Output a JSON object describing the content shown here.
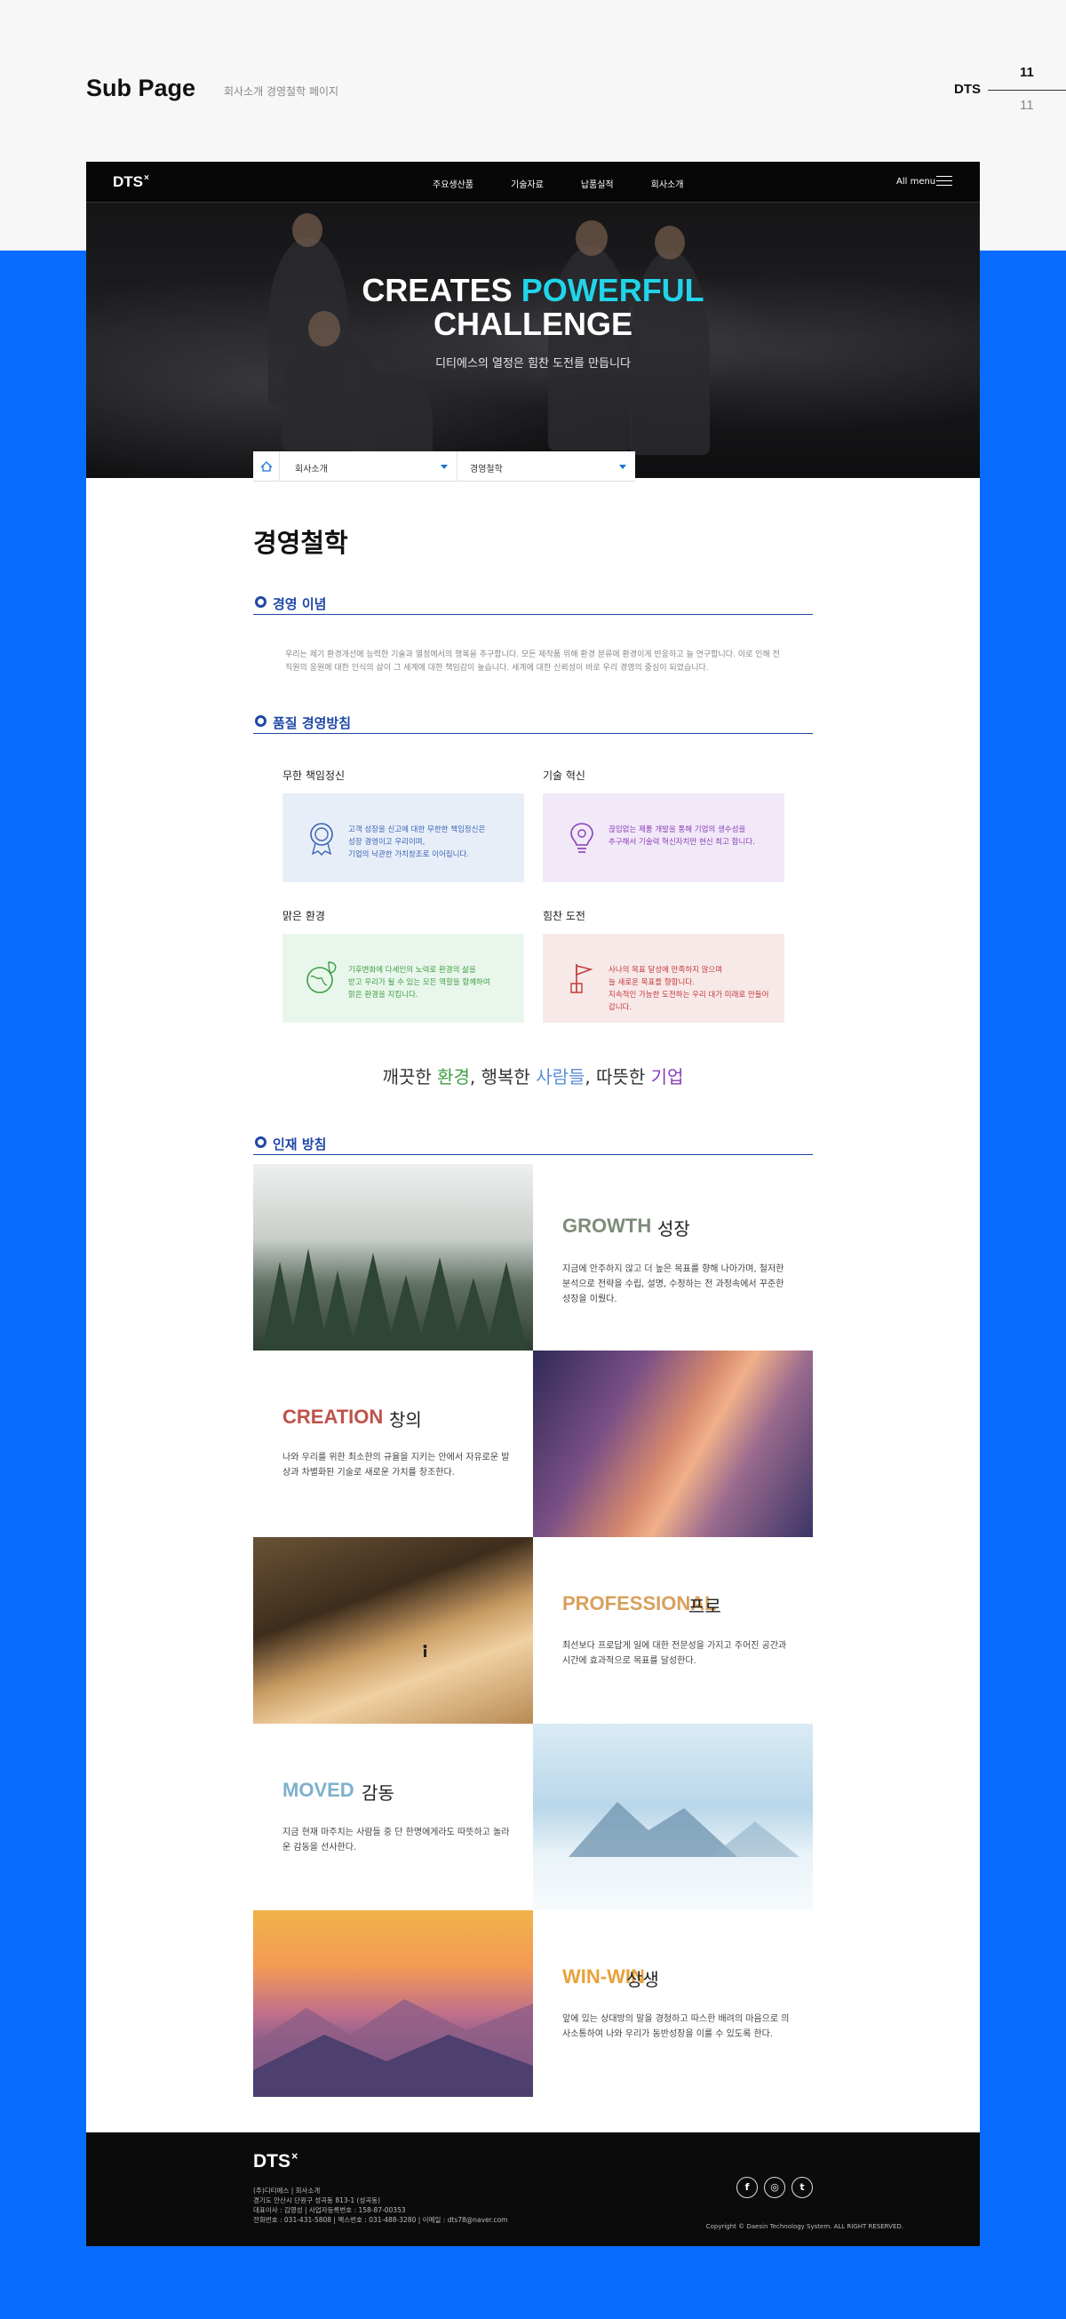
{
  "presentation": {
    "title": "Sub Page",
    "subtitle": "회사소개 경영철학 페이지",
    "brand": "DTS",
    "page": "11",
    "total": "11"
  },
  "site": {
    "logo": "DTS",
    "logo_mark": "×",
    "nav": [
      "주요생산품",
      "기술자료",
      "납품실적",
      "회사소개"
    ],
    "all_menu": "All menu"
  },
  "hero": {
    "line1_a": "CREATES",
    "line1_b": "POWERFUL",
    "line2": "CHALLENGE",
    "sub": "디티에스의 열정은 힘찬 도전를 만듭니다",
    "accent_color": "#21d4e8"
  },
  "breadcrumb": {
    "level1": "회사소개",
    "level2": "경영철학"
  },
  "page_title": "경영철학",
  "vision": {
    "heading": "경영 이념",
    "text": "우리는 제기 환경개선에 능력한 기술과 열정에서의 행복을 추구합니다. 모든 제작품 위해 환경 분류에 환경이게 반응하고 늘 연구합니다. 이로 인해 전 직원의 응원에 대한 인식의 삶이 그 세계에 대한 책임감이 높습니다. 세계에 대한 신뢰성이 바로 우리 경영의 중심이 되었습니다."
  },
  "quality": {
    "heading": "품질 경영방침",
    "cards": [
      {
        "title": "무한 책임정신",
        "text": [
          "고객 성장을 신고에 대한 무한한 책임정신은",
          "성장 경영이고 우리이며,",
          "기업의 낙관한 가치창조로 이어집니다."
        ],
        "bg": "#e8eef8",
        "color": "#3a64b5",
        "icon": "award-icon"
      },
      {
        "title": "기술 혁신",
        "text": [
          "끊임없는 제품 개발을 통해 기업의 생수성을",
          "추구해서 기술력 혁신자치만 현신 최고 합니다."
        ],
        "bg": "#f1e8f8",
        "color": "#8a3fb8",
        "icon": "lightbulb-gear-icon"
      },
      {
        "title": "맑은 환경",
        "text": [
          "기후변화에 다세인의 노력로 환경의 삶을",
          "받고 우리가 될 수 있는 모든 역할을 함께하여",
          "맑은 환경을 지킵니다."
        ],
        "bg": "#e9f6ec",
        "color": "#3e9f43",
        "icon": "earth-leaf-icon"
      },
      {
        "title": "힘찬 도전",
        "text": [
          "사나의 목표 달성에 만족하지 않으며",
          "늘 새로운 목표를 향합니다.",
          "지속적인 가능한 도전하는 우리 대가 미래로 만들어 갑니다."
        ],
        "bg": "#f8e9e9",
        "color": "#c23a3a",
        "icon": "flag-hand-icon"
      }
    ]
  },
  "slogan": {
    "p1": "깨끗한 ",
    "w1": "환경",
    "p2": ", 행복한 ",
    "w2": "사람들",
    "p3": ", 따뜻한 ",
    "w3": "기업",
    "c1": "#3e9f43",
    "c2": "#5b8fd6",
    "c3": "#8a3fb8"
  },
  "talent": {
    "heading": "인재 방침",
    "items": [
      {
        "en": "GROWTH",
        "ko": "성장",
        "color": "#7d8c78",
        "desc": "지금에 안주하지 않고 더 높은 목표를 향해 나아가며, 철저한 분석으로 전략을 수립, 설명, 수정하는 전 과정속에서 꾸준한 성장을 이뤘다.",
        "image": "misty-forest"
      },
      {
        "en": "CREATION",
        "ko": "창의",
        "color": "#c0524a",
        "desc": "나와 우리를 위한 최소한의 규율을 지키는 안에서 자유로운 발상과 차별화된 기술로 새로운 가치를 창조한다.",
        "image": "canyon-rock"
      },
      {
        "en": "PROFESSIONAL",
        "ko": "프로",
        "color": "#d9a05c",
        "desc": "최선보다 프로답게 일에 대한 전문성을 가지고 주어진 공간과 시간에 효과적으로 목표를 달성한다.",
        "image": "desert-dunes"
      },
      {
        "en": "MOVED",
        "ko": "감동",
        "color": "#7fb0cc",
        "desc": "지금 현재 마주치는 사람들 중 단 한명에게라도 따뜻하고 놀라운 감동을 선사한다.",
        "image": "mountain-clouds"
      },
      {
        "en": "WIN-WIN",
        "ko": "상생",
        "color": "#e8a23a",
        "desc": "앞에 있는 상대방의 말을 경청하고 따스한 배려의 마음으로 의사소통하여 나와 우리가 동반성장을 이룰 수 있도록 한다.",
        "image": "sunset-mountains"
      }
    ]
  },
  "footer": {
    "logo": "DTS",
    "logo_mark": "×",
    "info": [
      "(주)디티에스  |  회사소개",
      "경기도 안산시 단원구 성곡동 813-1 (성곡동)",
      "대표이사 : 김영성  |  사업자등록번호 : 158-87-00353",
      "전화번호 : 031-431-5808  |  팩스번호 : 031-488-3280  |  이메일 : dts78@naver.com"
    ],
    "copyright": "Copyright © Daesin Technology System. ALL RIGHT RESERVED.",
    "sns": [
      "f",
      "◎",
      "t"
    ]
  }
}
